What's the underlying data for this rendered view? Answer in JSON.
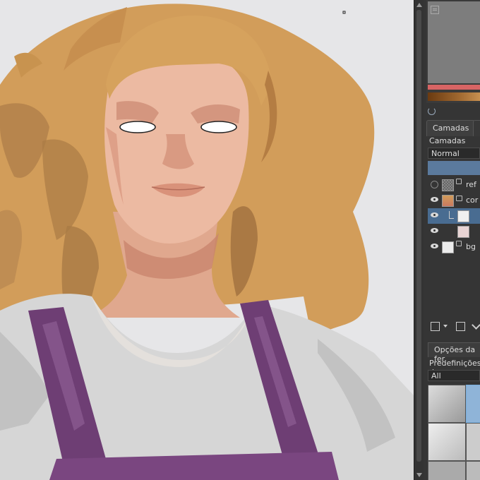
{
  "app": "Krita",
  "canvas": {
    "background": "#e6e6e8",
    "artwork": "digital-painting-portrait"
  },
  "colors": {
    "hair": "#d29d5a",
    "hair_shadow": "#a97a45",
    "skin": "#e9b39b",
    "skin_shadow": "#c9846e",
    "shirt": "#d8d8d8",
    "overalls": "#6e3e74",
    "hue_bar": "#d86464",
    "selection": "#496c91"
  },
  "dock": {
    "tab_layers": "Camadas",
    "layers_label": "Camadas",
    "blend_mode": "Normal",
    "layers": [
      {
        "name": "ref",
        "visible": false,
        "icon": "paint-layer-icon"
      },
      {
        "name": "cor",
        "visible": true,
        "icon": "group-layer-icon"
      },
      {
        "name": "",
        "visible": true,
        "icon": "paint-layer-icon",
        "selected": true
      },
      {
        "name": "",
        "visible": true,
        "icon": "paint-layer-icon"
      },
      {
        "name": "bg",
        "visible": true,
        "icon": "paint-layer-icon"
      }
    ],
    "tool_options_tab": "Opções da fer",
    "presets_label": "Predefinições do",
    "presets_filter": "All"
  }
}
